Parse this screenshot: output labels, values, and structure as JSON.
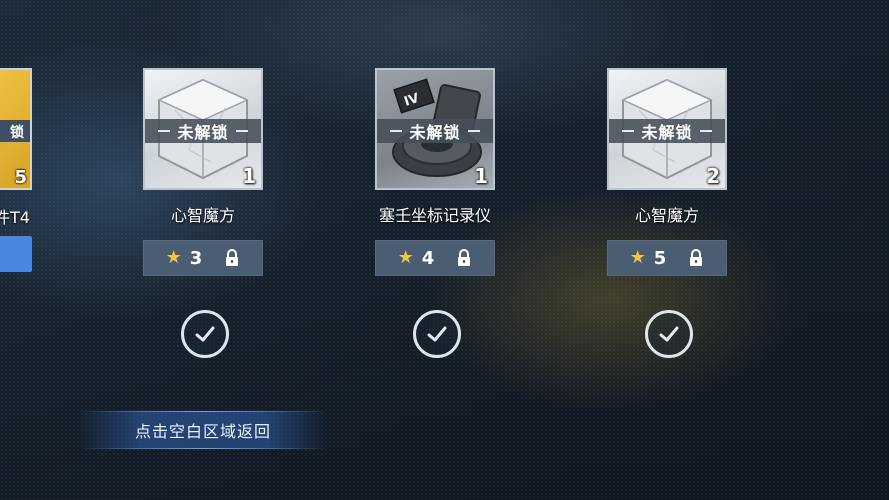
{
  "partial_item": {
    "name": "件T4",
    "count": "5"
  },
  "items": [
    {
      "name": "心智魔方",
      "lock_label": "未解锁",
      "count": "1",
      "stars": "3",
      "icon": "cube-icon",
      "badge": ""
    },
    {
      "name": "塞壬坐标记录仪",
      "lock_label": "未解锁",
      "count": "1",
      "stars": "4",
      "icon": "recorder-icon",
      "badge": "IV"
    },
    {
      "name": "心智魔方",
      "lock_label": "未解锁",
      "count": "2",
      "stars": "5",
      "icon": "cube-icon",
      "badge": ""
    }
  ],
  "return_hint": "点击空白区域返回",
  "colors": {
    "star": "#f5c542",
    "badge_bg": "#4a5d73",
    "hint_bg": "#28508c"
  }
}
